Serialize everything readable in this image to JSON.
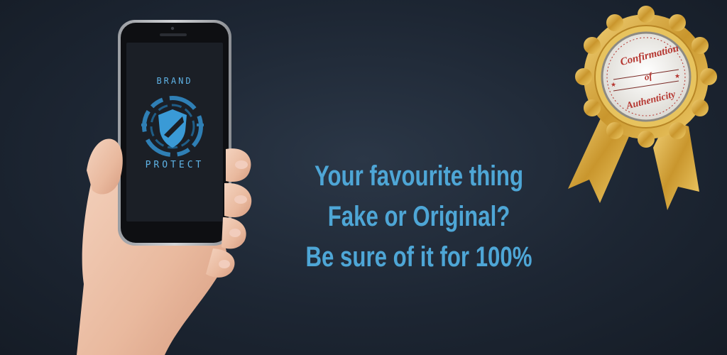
{
  "phone": {
    "brand_top": "BRAND",
    "brand_bottom": "PROTECT"
  },
  "tagline": {
    "line1": "Your favourite thing",
    "line2": "Fake or Original?",
    "line3": "Be sure of it for 100%"
  },
  "seal": {
    "line1": "Confirmation",
    "line2": "of",
    "line3": "Authenticity"
  },
  "colors": {
    "background": "#1d2633",
    "tagline": "#4ea6d6",
    "logo_accent": "#5fb3e6",
    "seal_gold": "#d4a63c",
    "seal_text": "#b5352f"
  }
}
